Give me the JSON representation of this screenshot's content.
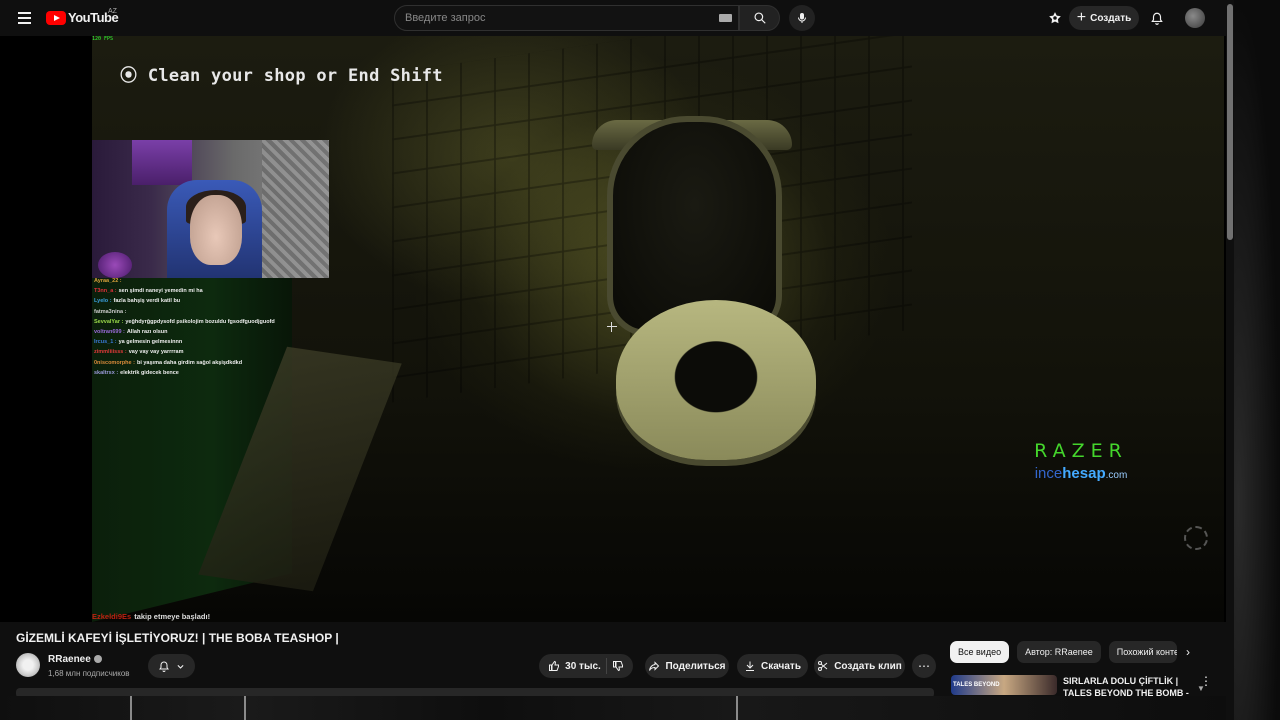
{
  "header": {
    "logo_text": "YouTube",
    "country_code": "AZ",
    "search_placeholder": "Введите запрос",
    "create_label": "Создать"
  },
  "player": {
    "fps_overlay": "120 FPS",
    "objective": "Clean your shop or End Shift",
    "chat": [
      {
        "user": "Ayraa_22 :",
        "text": "",
        "color": "#d9a23a"
      },
      {
        "user": "T3nn_a :",
        "text": "sen şimdi naneyi yemedin mi ha",
        "color": "#e0303a"
      },
      {
        "user": "Lyelo :",
        "text": "fazla bahşiş verdi katil bu",
        "color": "#3aa0e0"
      },
      {
        "user": "fatma3nina :",
        "text": "",
        "color": "#cccccc"
      },
      {
        "user": "SevvalYar :",
        "text": "yeğhdyrğgpdysofd psikolojim bozuldu fgsodfguodjguofd",
        "color": "#9ad94a"
      },
      {
        "user": "voltran699 :",
        "text": "Allah razı olsun",
        "color": "#9a6ad9"
      },
      {
        "user": "Ircus_1 :",
        "text": "ya gelmesin gelmesinnn",
        "color": "#3a7ad9"
      },
      {
        "user": "zimmliiisss :",
        "text": "vay vay vay yarrrram",
        "color": "#e03a3a"
      },
      {
        "user": "0niscomorphe :",
        "text": "bi yaşıma daha girdim sağol akşişdkdkd",
        "color": "#d98a3a"
      },
      {
        "user": "skaltrsx :",
        "text": "elektrik gidecek bence",
        "color": "#9a9ad9"
      }
    ],
    "follow_alert_user": "Ezkeldi9Es",
    "follow_alert_text": "takip etmeye başladı!",
    "sponsor_brand": "RAZER",
    "sponsor_site_prefix": "ince",
    "sponsor_site_bold": "hesap",
    "sponsor_site_suffix": ".com"
  },
  "video": {
    "title": "GİZEMLİ KAFEYİ İŞLETİYORUZ! | THE BOBA TEASHOP |",
    "channel_name": "RRaenee",
    "subscribers": "1,68 млн подписчиков",
    "likes": "30 тыс.",
    "share_label": "Поделиться",
    "download_label": "Скачать",
    "clip_label": "Создать клип"
  },
  "sidebar": {
    "chips": [
      "Все видео",
      "Автор: RRaenee",
      "Похожий контент"
    ],
    "rec_thumb_text": "TALES BEYOND",
    "rec_title": "SIRLARLA DOLU ÇİFTLİK | TALES BEYOND THE BOMB -"
  },
  "colors": {
    "background": "#0f0f0f",
    "youtube_red": "#ff0000",
    "razer_green": "#44d62c",
    "pill_bg": "#272727"
  }
}
